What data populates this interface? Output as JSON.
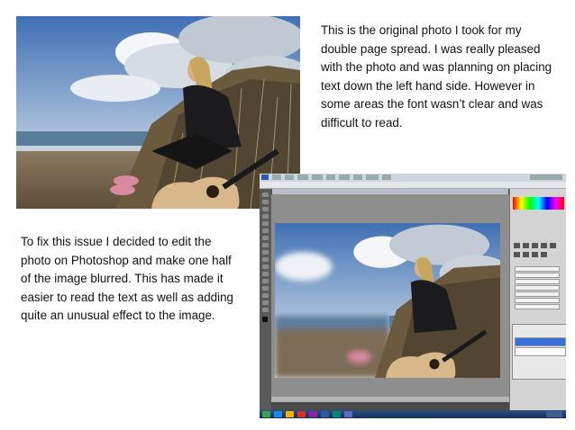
{
  "paragraphs": {
    "original_photo": "This is the original photo I took for my double page spread. I was really pleased with the photo and was planning on placing text down the left hand side. However in some areas the font wasn’t clear and was difficult to read.",
    "fix_description": "To fix this issue I decided to edit the photo on Photoshop and make one half of the image blurred. This has made it easier to read the text as well as adding quite an unusual effect to the image."
  },
  "icons": {
    "photoshop_logo": "ps-logo-icon",
    "tool_icons": "tool-icon",
    "taskbar_icons": "taskbar-app-icon"
  },
  "colors": {
    "sky_top": "#3f6fb4",
    "sky_bottom": "#dfe6ee",
    "sea": "#5b7d9c",
    "grass": "#6b5a3d",
    "guitar": "#d8b88a",
    "coat": "#1b1b1d",
    "ps_dark": "#4a4a4a",
    "layer_selected": "#3a6fd8"
  }
}
